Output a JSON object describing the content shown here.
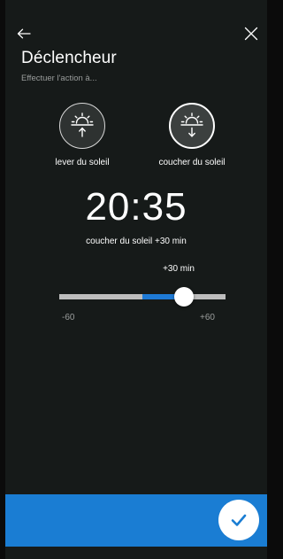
{
  "header": {
    "back_icon": "arrow-left-icon",
    "close_icon": "close-icon",
    "title": "Déclencheur",
    "subtitle": "Effectuer l'action à..."
  },
  "options": [
    {
      "label": "lever du soleil",
      "icon": "sunrise-icon",
      "selected": false
    },
    {
      "label": "coucher du soleil",
      "icon": "sunset-icon",
      "selected": true
    }
  ],
  "time": {
    "value": "20:35",
    "caption": "coucher du soleil +30 min"
  },
  "slider": {
    "current_label": "+30 min",
    "min_label": "-60",
    "max_label": "+60",
    "min": -60,
    "max": 60,
    "value": 30
  },
  "footer": {
    "confirm_icon": "check-icon"
  },
  "colors": {
    "background": "#161a19",
    "accent": "#1e7ad6",
    "footer": "#1a7dd3",
    "track": "#bdbdbd"
  }
}
